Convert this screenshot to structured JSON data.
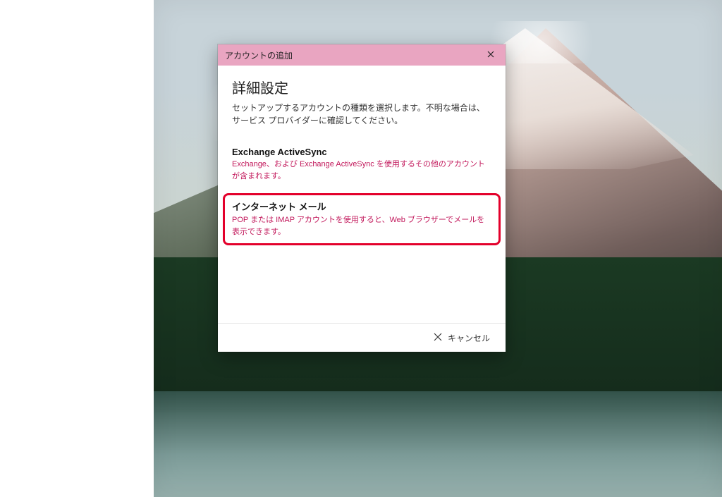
{
  "dialog": {
    "titlebar": "アカウントの追加",
    "heading": "詳細設定",
    "subtext": "セットアップするアカウントの種類を選択します。不明な場合は、サービス プロバイダーに確認してください。",
    "options": [
      {
        "title": "Exchange ActiveSync",
        "desc": "Exchange、および Exchange ActiveSync を使用するその他のアカウントが含まれます。"
      },
      {
        "title": "インターネット メール",
        "desc": "POP または IMAP アカウントを使用すると、Web ブラウザーでメールを表示できます。"
      }
    ],
    "cancel_label": "キャンセル"
  },
  "colors": {
    "titlebar_bg": "#e9a5c1",
    "accent_text": "#c2185b",
    "highlight_border": "#e3002b"
  }
}
